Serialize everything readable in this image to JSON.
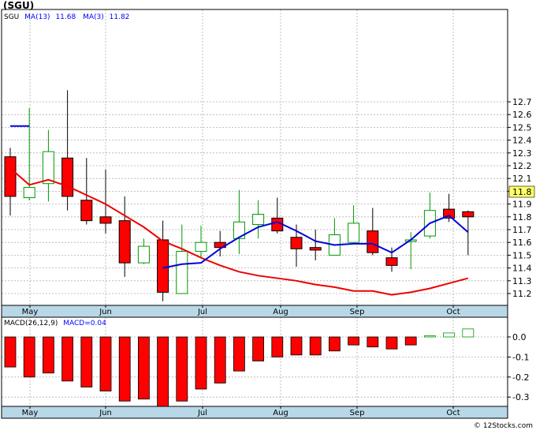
{
  "header": {
    "ticker": "(SGU)",
    "price_legend": [
      {
        "label": "SGU",
        "color": "#000000"
      },
      {
        "label": "MA(13)",
        "value": "11.68",
        "color": "#0000ff"
      },
      {
        "label": "MA(3)",
        "value": "11.82",
        "color": "#0000ff"
      }
    ],
    "macd_legend": [
      {
        "label": "MACD(26,12,9)",
        "color": "#000000"
      },
      {
        "label": "MACD=0.04",
        "color": "#0000ff"
      }
    ],
    "last_price": "11.8",
    "watermark": "© 12Stocks.com"
  },
  "colors": {
    "up_body": "#ffffff",
    "up_border": "#009900",
    "down_body": "#ff0000",
    "down_border": "#000000",
    "ma13_line": "#ee0000",
    "ma3_line": "#0000dd",
    "macd_positive": "#ffffff",
    "macd_positive_border": "#009900",
    "macd_negative": "#ff0000",
    "axis_band": "#b8d8e8",
    "grid": "#b0b0b0"
  },
  "chart_data": [
    {
      "type": "candlestick",
      "title": "(SGU)",
      "x_month_labels": [
        "May",
        "Jun",
        "Jul",
        "Aug",
        "Sep",
        "Oct"
      ],
      "ylim": [
        11.1,
        12.8
      ],
      "y_ticks": [
        11.2,
        11.3,
        11.4,
        11.5,
        11.6,
        11.7,
        11.8,
        11.9,
        12.0,
        12.1,
        12.2,
        12.3,
        12.4,
        12.5,
        12.6,
        12.7
      ],
      "grid": true,
      "candles": [
        {
          "open": 12.27,
          "high": 12.34,
          "low": 11.81,
          "close": 11.96
        },
        {
          "open": 11.95,
          "high": 12.65,
          "low": 11.93,
          "close": 12.03
        },
        {
          "open": 12.06,
          "high": 12.48,
          "low": 11.92,
          "close": 12.31
        },
        {
          "open": 12.26,
          "high": 12.79,
          "low": 11.85,
          "close": 11.96
        },
        {
          "open": 11.93,
          "high": 12.26,
          "low": 11.74,
          "close": 11.77
        },
        {
          "open": 11.8,
          "high": 12.17,
          "low": 11.67,
          "close": 11.75
        },
        {
          "open": 11.77,
          "high": 11.96,
          "low": 11.33,
          "close": 11.44
        },
        {
          "open": 11.44,
          "high": 11.63,
          "low": 11.43,
          "close": 11.57
        },
        {
          "open": 11.62,
          "high": 11.77,
          "low": 11.14,
          "close": 11.21
        },
        {
          "open": 11.2,
          "high": 11.74,
          "low": 11.2,
          "close": 11.53
        },
        {
          "open": 11.53,
          "high": 11.73,
          "low": 11.48,
          "close": 11.6
        },
        {
          "open": 11.6,
          "high": 11.69,
          "low": 11.49,
          "close": 11.56
        },
        {
          "open": 11.63,
          "high": 12.01,
          "low": 11.51,
          "close": 11.76
        },
        {
          "open": 11.74,
          "high": 11.93,
          "low": 11.63,
          "close": 11.82
        },
        {
          "open": 11.79,
          "high": 11.95,
          "low": 11.67,
          "close": 11.69
        },
        {
          "open": 11.64,
          "high": 11.74,
          "low": 11.41,
          "close": 11.55
        },
        {
          "open": 11.56,
          "high": 11.7,
          "low": 11.46,
          "close": 11.54
        },
        {
          "open": 11.5,
          "high": 11.79,
          "low": 11.5,
          "close": 11.66
        },
        {
          "open": 11.6,
          "high": 11.89,
          "low": 11.59,
          "close": 11.75
        },
        {
          "open": 11.69,
          "high": 11.87,
          "low": 11.5,
          "close": 11.52
        },
        {
          "open": 11.48,
          "high": 11.56,
          "low": 11.37,
          "close": 11.42
        },
        {
          "open": 11.61,
          "high": 11.68,
          "low": 11.39,
          "close": 11.62
        },
        {
          "open": 11.65,
          "high": 11.99,
          "low": 11.63,
          "close": 11.85
        },
        {
          "open": 11.86,
          "high": 11.98,
          "low": 11.76,
          "close": 11.79
        },
        {
          "open": 11.84,
          "high": 11.85,
          "low": 11.5,
          "close": 11.8
        }
      ],
      "series": [
        {
          "name": "MA(13)",
          "color": "#ee0000",
          "start_index": 0,
          "values": [
            12.18,
            12.05,
            12.09,
            12.04,
            11.97,
            11.9,
            11.81,
            11.72,
            11.61,
            11.55,
            11.48,
            11.42,
            11.37,
            11.34,
            11.32,
            11.3,
            11.27,
            11.25,
            11.22,
            11.22,
            11.19,
            11.21,
            11.24,
            11.28,
            11.32
          ]
        },
        {
          "name": "MA(3)",
          "color": "#0000dd",
          "start_index": 0,
          "values": [
            12.51,
            12.51,
            null,
            null,
            null,
            null,
            null,
            null,
            11.4,
            11.43,
            11.44,
            11.55,
            11.64,
            11.72,
            11.76,
            11.69,
            11.61,
            11.58,
            11.59,
            11.59,
            11.52,
            11.62,
            11.75,
            11.81,
            11.68
          ]
        }
      ]
    },
    {
      "type": "bar",
      "title": "MACD(26,12,9)",
      "x_month_labels": [
        "May",
        "Jun",
        "Jul",
        "Aug",
        "Sep",
        "Oct"
      ],
      "ylim": [
        -0.36,
        0.07
      ],
      "y_ticks": [
        0.0,
        -0.1,
        -0.2,
        -0.3
      ],
      "y_tick_labels": [
        "0.0",
        "-0.1",
        "-0.2",
        "-0.3"
      ],
      "grid": true,
      "values": [
        -0.15,
        -0.2,
        -0.18,
        -0.22,
        -0.25,
        -0.27,
        -0.32,
        -0.31,
        -0.35,
        -0.32,
        -0.26,
        -0.23,
        -0.17,
        -0.12,
        -0.1,
        -0.09,
        -0.09,
        -0.07,
        -0.04,
        -0.05,
        -0.06,
        -0.04,
        0.0,
        0.02,
        0.04
      ]
    }
  ]
}
